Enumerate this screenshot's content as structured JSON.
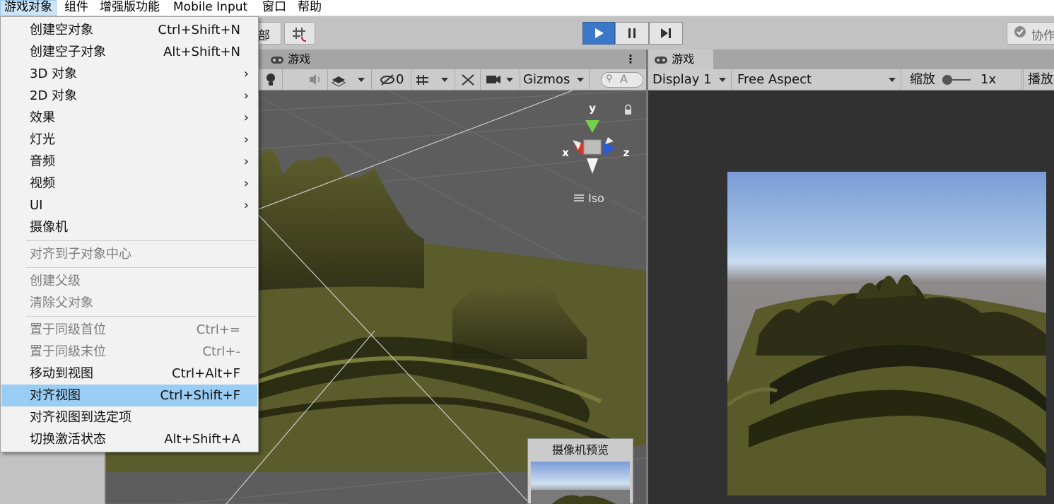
{
  "menubar": {
    "items": [
      "游戏对象",
      "组件",
      "增强版功能",
      "Mobile Input",
      "窗口",
      "帮助"
    ]
  },
  "toolbar": {
    "left_button_label": "部",
    "collab_label": "协作"
  },
  "scene_panel": {
    "tab_label": "游戏",
    "gizmos_label": "Gizmos",
    "search_placeholder": "A",
    "hidden_count": "0",
    "iso_label": "Iso",
    "axis_y": "y",
    "axis_x": "x",
    "axis_z": "z",
    "camera_preview_title": "摄像机预览"
  },
  "game_panel": {
    "tab_label": "游戏",
    "display": "Display 1",
    "aspect": "Free Aspect",
    "scale_label": "缩放",
    "scale_value": "1x",
    "play_label": "播放"
  },
  "menu": {
    "items": [
      {
        "label": "创建空对象",
        "shortcut": "Ctrl+Shift+N"
      },
      {
        "label": "创建空子对象",
        "shortcut": "Alt+Shift+N"
      },
      {
        "label": "3D 对象",
        "shortcut": ""
      },
      {
        "label": "2D 对象",
        "shortcut": ""
      },
      {
        "label": "效果",
        "shortcut": ""
      },
      {
        "label": "灯光",
        "shortcut": ""
      },
      {
        "label": "音频",
        "shortcut": ""
      },
      {
        "label": "视频",
        "shortcut": ""
      },
      {
        "label": "UI",
        "shortcut": ""
      },
      {
        "label": "摄像机",
        "shortcut": ""
      },
      {
        "label": "对齐到子对象中心",
        "shortcut": ""
      },
      {
        "label": "创建父级",
        "shortcut": ""
      },
      {
        "label": "清除父对象",
        "shortcut": ""
      },
      {
        "label": "置于同级首位",
        "shortcut": "Ctrl+="
      },
      {
        "label": "置于同级末位",
        "shortcut": "Ctrl+-"
      },
      {
        "label": "移动到视图",
        "shortcut": "Ctrl+Alt+F"
      },
      {
        "label": "对齐视图",
        "shortcut": "Ctrl+Shift+F"
      },
      {
        "label": "对齐视图到选定项",
        "shortcut": ""
      },
      {
        "label": "切换激活状态",
        "shortcut": "Alt+Shift+A"
      }
    ]
  },
  "colors": {
    "menu_highlight": "#99cdf4",
    "play_active": "#3c78c8",
    "terrain": "#5c5c2c",
    "sky_top": "#7a9bd6",
    "sky_horizon": "#c9dcf0"
  }
}
